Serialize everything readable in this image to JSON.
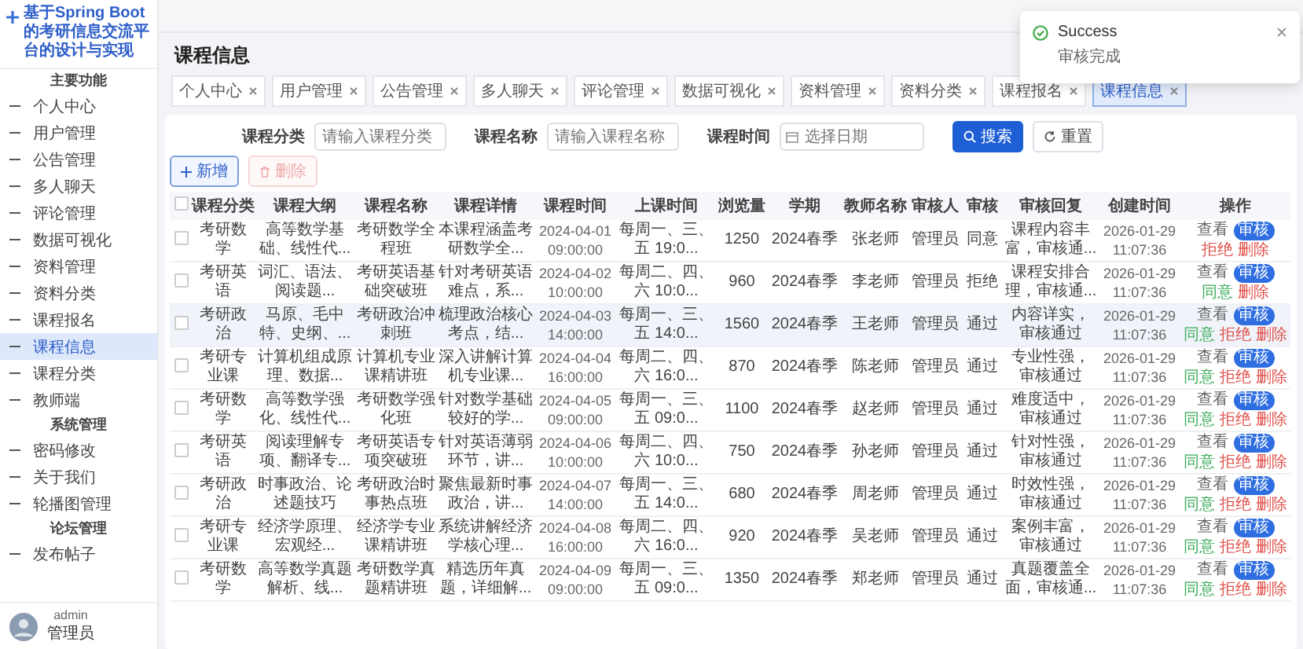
{
  "sidebar": {
    "title": "基于Spring Boot的考研信息交流平台的设计与实现",
    "groups": [
      {
        "heading": "主要功能",
        "items": [
          {
            "label": "个人中心",
            "selected": false
          },
          {
            "label": "用户管理",
            "selected": false
          },
          {
            "label": "公告管理",
            "selected": false
          },
          {
            "label": "多人聊天",
            "selected": false
          },
          {
            "label": "评论管理",
            "selected": false
          },
          {
            "label": "数据可视化",
            "selected": false
          },
          {
            "label": "资料管理",
            "selected": false
          },
          {
            "label": "资料分类",
            "selected": false
          },
          {
            "label": "课程报名",
            "selected": false
          },
          {
            "label": "课程信息",
            "selected": true
          },
          {
            "label": "课程分类",
            "selected": false
          },
          {
            "label": "教师端",
            "selected": false
          }
        ]
      },
      {
        "heading": "系统管理",
        "items": [
          {
            "label": "密码修改",
            "selected": false
          },
          {
            "label": "关于我们",
            "selected": false
          },
          {
            "label": "轮播图管理",
            "selected": false
          }
        ]
      },
      {
        "heading": "论坛管理",
        "items": [
          {
            "label": "发布帖子",
            "selected": false
          }
        ]
      }
    ],
    "user": {
      "name": "admin",
      "role": "管理员"
    }
  },
  "page_title": "课程信息",
  "tabs": [
    {
      "label": "个人中心",
      "selected": false
    },
    {
      "label": "用户管理",
      "selected": false
    },
    {
      "label": "公告管理",
      "selected": false
    },
    {
      "label": "多人聊天",
      "selected": false
    },
    {
      "label": "评论管理",
      "selected": false
    },
    {
      "label": "数据可视化",
      "selected": false
    },
    {
      "label": "资料管理",
      "selected": false
    },
    {
      "label": "资料分类",
      "selected": false
    },
    {
      "label": "课程报名",
      "selected": false
    },
    {
      "label": "课程信息",
      "selected": true
    }
  ],
  "filters": [
    {
      "label": "课程分类",
      "placeholder": "请输入课程分类",
      "kind": "text"
    },
    {
      "label": "课程名称",
      "placeholder": "请输入课程名称",
      "kind": "text"
    },
    {
      "label": "课程时间",
      "placeholder": "选择日期",
      "kind": "date"
    }
  ],
  "search_button": "搜索",
  "reset_button": "重置",
  "add_button": {
    "label": "新增",
    "disabled": false
  },
  "delete_button": {
    "label": "删除",
    "disabled": true
  },
  "table": {
    "all_checked": false,
    "columns": [
      "课程分类",
      "课程大纲",
      "课程名称",
      "课程详情",
      "课程时间",
      "上课时间",
      "浏览量",
      "学期",
      "教师名称",
      "审核人",
      "审核",
      "审核回复",
      "创建时间",
      "操作"
    ],
    "rows": [
      {
        "checked": false,
        "hovered": false,
        "cells": [
          "考研数学",
          "高等数学基础、线性代...",
          "考研数学全程班",
          "本课程涵盖考研数学全...",
          "2024-04-01 09:00:00",
          "每周一、三、五 19:0...",
          "1250",
          "2024春季",
          "张老师",
          "管理员",
          "同意",
          "课程内容丰富，审核通...",
          "2026-01-29 11:07:36"
        ],
        "actions": [
          {
            "kind": "view",
            "label": "查看"
          },
          {
            "kind": "audit",
            "label": "审核"
          },
          {
            "kind": "reject",
            "label": "拒绝"
          },
          {
            "kind": "delete",
            "label": "删除"
          }
        ]
      },
      {
        "checked": false,
        "hovered": false,
        "cells": [
          "考研英语",
          "词汇、语法、阅读题...",
          "考研英语基础突破班",
          "针对考研英语难点，系...",
          "2024-04-02 10:00:00",
          "每周二、四、六 10:0...",
          "960",
          "2024春季",
          "李老师",
          "管理员",
          "拒绝",
          "课程安排合理，审核通...",
          "2026-01-29 11:07:36"
        ],
        "actions": [
          {
            "kind": "view",
            "label": "查看"
          },
          {
            "kind": "audit",
            "label": "审核"
          },
          {
            "kind": "approve",
            "label": "同意"
          },
          {
            "kind": "delete",
            "label": "删除"
          }
        ]
      },
      {
        "checked": false,
        "hovered": true,
        "cells": [
          "考研政治",
          "马原、毛中特、史纲、...",
          "考研政治冲刺班",
          "梳理政治核心考点，结...",
          "2024-04-03 14:00:00",
          "每周一、三、五 14:0...",
          "1560",
          "2024春季",
          "王老师",
          "管理员",
          "通过",
          "内容详实，审核通过",
          "2026-01-29 11:07:36"
        ],
        "actions": [
          {
            "kind": "view",
            "label": "查看"
          },
          {
            "kind": "audit",
            "label": "审核"
          },
          {
            "kind": "approve",
            "label": "同意"
          },
          {
            "kind": "reject",
            "label": "拒绝"
          },
          {
            "kind": "delete",
            "label": "删除"
          }
        ]
      },
      {
        "checked": false,
        "hovered": false,
        "cells": [
          "考研专业课",
          "计算机组成原理、数据...",
          "计算机专业课精讲班",
          "深入讲解计算机专业课...",
          "2024-04-04 16:00:00",
          "每周二、四、六 16:0...",
          "870",
          "2024春季",
          "陈老师",
          "管理员",
          "通过",
          "专业性强，审核通过",
          "2026-01-29 11:07:36"
        ],
        "actions": [
          {
            "kind": "view",
            "label": "查看"
          },
          {
            "kind": "audit",
            "label": "审核"
          },
          {
            "kind": "approve",
            "label": "同意"
          },
          {
            "kind": "reject",
            "label": "拒绝"
          },
          {
            "kind": "delete",
            "label": "删除"
          }
        ]
      },
      {
        "checked": false,
        "hovered": false,
        "cells": [
          "考研数学",
          "高等数学强化、线性代...",
          "考研数学强化班",
          "针对数学基础较好的学...",
          "2024-04-05 09:00:00",
          "每周一、三、五 09:0...",
          "1100",
          "2024春季",
          "赵老师",
          "管理员",
          "通过",
          "难度适中，审核通过",
          "2026-01-29 11:07:36"
        ],
        "actions": [
          {
            "kind": "view",
            "label": "查看"
          },
          {
            "kind": "audit",
            "label": "审核"
          },
          {
            "kind": "approve",
            "label": "同意"
          },
          {
            "kind": "reject",
            "label": "拒绝"
          },
          {
            "kind": "delete",
            "label": "删除"
          }
        ]
      },
      {
        "checked": false,
        "hovered": false,
        "cells": [
          "考研英语",
          "阅读理解专项、翻译专...",
          "考研英语专项突破班",
          "针对英语薄弱环节，讲...",
          "2024-04-06 10:00:00",
          "每周二、四、六 10:0...",
          "750",
          "2024春季",
          "孙老师",
          "管理员",
          "通过",
          "针对性强，审核通过",
          "2026-01-29 11:07:36"
        ],
        "actions": [
          {
            "kind": "view",
            "label": "查看"
          },
          {
            "kind": "audit",
            "label": "审核"
          },
          {
            "kind": "approve",
            "label": "同意"
          },
          {
            "kind": "reject",
            "label": "拒绝"
          },
          {
            "kind": "delete",
            "label": "删除"
          }
        ]
      },
      {
        "checked": false,
        "hovered": false,
        "cells": [
          "考研政治",
          "时事政治、论述题技巧",
          "考研政治时事热点班",
          "聚焦最新时事政治，讲...",
          "2024-04-07 14:00:00",
          "每周一、三、五 14:0...",
          "680",
          "2024春季",
          "周老师",
          "管理员",
          "通过",
          "时效性强，审核通过",
          "2026-01-29 11:07:36"
        ],
        "actions": [
          {
            "kind": "view",
            "label": "查看"
          },
          {
            "kind": "audit",
            "label": "审核"
          },
          {
            "kind": "approve",
            "label": "同意"
          },
          {
            "kind": "reject",
            "label": "拒绝"
          },
          {
            "kind": "delete",
            "label": "删除"
          }
        ]
      },
      {
        "checked": false,
        "hovered": false,
        "cells": [
          "考研专业课",
          "经济学原理、宏观经...",
          "经济学专业课精讲班",
          "系统讲解经济学核心理...",
          "2024-04-08 16:00:00",
          "每周二、四、六 16:0...",
          "920",
          "2024春季",
          "吴老师",
          "管理员",
          "通过",
          "案例丰富，审核通过",
          "2026-01-29 11:07:36"
        ],
        "actions": [
          {
            "kind": "view",
            "label": "查看"
          },
          {
            "kind": "audit",
            "label": "审核"
          },
          {
            "kind": "approve",
            "label": "同意"
          },
          {
            "kind": "reject",
            "label": "拒绝"
          },
          {
            "kind": "delete",
            "label": "删除"
          }
        ]
      },
      {
        "checked": false,
        "hovered": false,
        "cells": [
          "考研数学",
          "高等数学真题解析、线...",
          "考研数学真题精讲班",
          "精选历年真题，详细解...",
          "2024-04-09 09:00:00",
          "每周一、三、五 09:0...",
          "1350",
          "2024春季",
          "郑老师",
          "管理员",
          "通过",
          "真题覆盖全面，审核通...",
          "2026-01-29 11:07:36"
        ],
        "actions": [
          {
            "kind": "view",
            "label": "查看"
          },
          {
            "kind": "audit",
            "label": "审核"
          },
          {
            "kind": "approve",
            "label": "同意"
          },
          {
            "kind": "reject",
            "label": "拒绝"
          },
          {
            "kind": "delete",
            "label": "删除"
          }
        ]
      }
    ]
  },
  "toast": {
    "title": "Success",
    "message": "审核完成"
  }
}
